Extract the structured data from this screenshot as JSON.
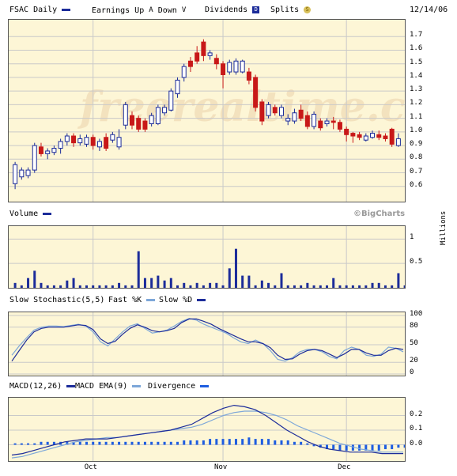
{
  "header": {
    "symbol_label": "FSAC Daily",
    "earnings_label": "Earnings Up",
    "earnings_up_glyph": "A",
    "earnings_down_label": "Down",
    "earnings_down_glyph": "V",
    "dividends_label": "Dividends",
    "dividends_glyph": "D",
    "splits_label": "Splits",
    "splits_glyph": "S",
    "date": "12/14/06"
  },
  "watermark": "freerealtime.com",
  "copyright": "©BigCharts",
  "panels": {
    "volume_label": "Volume",
    "volume_units": "Millions",
    "stoch_label": "Slow Stochastic(5,5)",
    "stoch_fast": "Fast %K",
    "stoch_slow": "Slow %D",
    "macd_label": "MACD(12,26)",
    "macd_ema": "MACD EMA(9)",
    "macd_div": "Divergence"
  },
  "colors": {
    "up": "#1c2c9a",
    "down": "#c81818",
    "fast": "#7da7d9",
    "panel_bg": "#fdf6d6",
    "grid": "#c9c9c9"
  },
  "chart_data": {
    "type": "candlestick",
    "x_ticks": [
      "Oct",
      "Nov",
      "Dec"
    ],
    "x_tick_index": [
      12,
      32,
      51
    ],
    "price_axis": {
      "ylim": [
        0.5,
        1.8
      ],
      "ticks": [
        0.6,
        0.7,
        0.8,
        0.9,
        1.0,
        1.1,
        1.2,
        1.3,
        1.4,
        1.5,
        1.6,
        1.7
      ]
    },
    "candles": [
      {
        "o": 0.62,
        "c": 0.76,
        "h": 0.78,
        "l": 0.58
      },
      {
        "o": 0.67,
        "c": 0.72,
        "h": 0.74,
        "l": 0.65
      },
      {
        "o": 0.68,
        "c": 0.72,
        "h": 0.74,
        "l": 0.66
      },
      {
        "o": 0.72,
        "c": 0.9,
        "h": 0.92,
        "l": 0.7
      },
      {
        "o": 0.89,
        "c": 0.84,
        "h": 0.92,
        "l": 0.82
      },
      {
        "o": 0.84,
        "c": 0.86,
        "h": 0.88,
        "l": 0.8
      },
      {
        "o": 0.85,
        "c": 0.88,
        "h": 0.9,
        "l": 0.83
      },
      {
        "o": 0.88,
        "c": 0.93,
        "h": 0.95,
        "l": 0.84
      },
      {
        "o": 0.93,
        "c": 0.97,
        "h": 0.99,
        "l": 0.9
      },
      {
        "o": 0.97,
        "c": 0.92,
        "h": 0.99,
        "l": 0.89
      },
      {
        "o": 0.92,
        "c": 0.95,
        "h": 0.98,
        "l": 0.9
      },
      {
        "o": 0.91,
        "c": 0.96,
        "h": 0.98,
        "l": 0.89
      },
      {
        "o": 0.96,
        "c": 0.9,
        "h": 0.98,
        "l": 0.87
      },
      {
        "o": 0.89,
        "c": 0.93,
        "h": 0.95,
        "l": 0.86
      },
      {
        "o": 0.96,
        "c": 0.88,
        "h": 0.99,
        "l": 0.86
      },
      {
        "o": 0.94,
        "c": 0.98,
        "h": 1.0,
        "l": 0.92
      },
      {
        "o": 0.89,
        "c": 0.96,
        "h": 1.02,
        "l": 0.87
      },
      {
        "o": 1.05,
        "c": 1.2,
        "h": 1.22,
        "l": 1.02
      },
      {
        "o": 1.12,
        "c": 1.05,
        "h": 1.15,
        "l": 1.02
      },
      {
        "o": 1.1,
        "c": 1.02,
        "h": 1.12,
        "l": 1.0
      },
      {
        "o": 1.08,
        "c": 1.02,
        "h": 1.1,
        "l": 1.0
      },
      {
        "o": 1.06,
        "c": 1.12,
        "h": 1.14,
        "l": 1.04
      },
      {
        "o": 1.06,
        "c": 1.18,
        "h": 1.2,
        "l": 1.05
      },
      {
        "o": 1.14,
        "c": 1.18,
        "h": 1.2,
        "l": 1.12
      },
      {
        "o": 1.16,
        "c": 1.3,
        "h": 1.32,
        "l": 1.15
      },
      {
        "o": 1.28,
        "c": 1.38,
        "h": 1.4,
        "l": 1.25
      },
      {
        "o": 1.4,
        "c": 1.48,
        "h": 1.5,
        "l": 1.37
      },
      {
        "o": 1.52,
        "c": 1.48,
        "h": 1.55,
        "l": 1.44
      },
      {
        "o": 1.58,
        "c": 1.52,
        "h": 1.63,
        "l": 1.5
      },
      {
        "o": 1.66,
        "c": 1.56,
        "h": 1.68,
        "l": 1.52
      },
      {
        "o": 1.56,
        "c": 1.58,
        "h": 1.6,
        "l": 1.53
      },
      {
        "o": 1.54,
        "c": 1.5,
        "h": 1.57,
        "l": 1.46
      },
      {
        "o": 1.5,
        "c": 1.42,
        "h": 1.52,
        "l": 1.32
      },
      {
        "o": 1.44,
        "c": 1.51,
        "h": 1.53,
        "l": 1.42
      },
      {
        "o": 1.44,
        "c": 1.52,
        "h": 1.54,
        "l": 1.42
      },
      {
        "o": 1.44,
        "c": 1.52,
        "h": 1.53,
        "l": 1.43
      },
      {
        "o": 1.44,
        "c": 1.38,
        "h": 1.47,
        "l": 1.35
      },
      {
        "o": 1.4,
        "c": 1.18,
        "h": 1.42,
        "l": 1.15
      },
      {
        "o": 1.22,
        "c": 1.08,
        "h": 1.24,
        "l": 1.05
      },
      {
        "o": 1.12,
        "c": 1.2,
        "h": 1.22,
        "l": 1.1
      },
      {
        "o": 1.18,
        "c": 1.14,
        "h": 1.2,
        "l": 1.12
      },
      {
        "o": 1.12,
        "c": 1.18,
        "h": 1.2,
        "l": 1.1
      },
      {
        "o": 1.08,
        "c": 1.1,
        "h": 1.13,
        "l": 1.05
      },
      {
        "o": 1.08,
        "c": 1.14,
        "h": 1.17,
        "l": 1.06
      },
      {
        "o": 1.16,
        "c": 1.1,
        "h": 1.2,
        "l": 1.08
      },
      {
        "o": 1.12,
        "c": 1.04,
        "h": 1.15,
        "l": 1.02
      },
      {
        "o": 1.04,
        "c": 1.13,
        "h": 1.15,
        "l": 1.02
      },
      {
        "o": 1.08,
        "c": 1.03,
        "h": 1.1,
        "l": 1.01
      },
      {
        "o": 1.06,
        "c": 1.08,
        "h": 1.1,
        "l": 1.04
      },
      {
        "o": 1.08,
        "c": 1.07,
        "h": 1.11,
        "l": 1.02
      },
      {
        "o": 1.07,
        "c": 1.02,
        "h": 1.09,
        "l": 1.0
      },
      {
        "o": 1.02,
        "c": 0.98,
        "h": 1.04,
        "l": 0.93
      },
      {
        "o": 0.99,
        "c": 0.97,
        "h": 1.0,
        "l": 0.92
      },
      {
        "o": 0.98,
        "c": 0.96,
        "h": 1.0,
        "l": 0.94
      },
      {
        "o": 0.94,
        "c": 0.97,
        "h": 0.99,
        "l": 0.93
      },
      {
        "o": 0.96,
        "c": 0.99,
        "h": 1.01,
        "l": 0.95
      },
      {
        "o": 0.98,
        "c": 0.96,
        "h": 1.01,
        "l": 0.94
      },
      {
        "o": 0.97,
        "c": 0.95,
        "h": 0.99,
        "l": 0.93
      },
      {
        "o": 1.02,
        "c": 0.91,
        "h": 1.03,
        "l": 0.89
      },
      {
        "o": 0.9,
        "c": 0.95,
        "h": 0.99,
        "l": 0.89
      }
    ],
    "volume": {
      "ylim": [
        0,
        1.2
      ],
      "ticks": [
        0.5,
        1
      ],
      "values": [
        0.1,
        0.05,
        0.2,
        0.35,
        0.1,
        0.05,
        0.05,
        0.05,
        0.15,
        0.2,
        0.05,
        0.05,
        0.05,
        0.05,
        0.05,
        0.05,
        0.1,
        0.05,
        0.05,
        0.75,
        0.2,
        0.2,
        0.25,
        0.15,
        0.2,
        0.05,
        0.1,
        0.05,
        0.1,
        0.05,
        0.1,
        0.1,
        0.05,
        0.4,
        0.8,
        0.25,
        0.25,
        0.05,
        0.15,
        0.1,
        0.05,
        0.3,
        0.05,
        0.05,
        0.05,
        0.1,
        0.05,
        0.05,
        0.05,
        0.2,
        0.05,
        0.05,
        0.05,
        0.05,
        0.05,
        0.1,
        0.1,
        0.05,
        0.05,
        0.3,
        0.05,
        0.05,
        0.1,
        1.15
      ]
    },
    "stochastic": {
      "ylim": [
        0,
        100
      ],
      "ticks": [
        0,
        20,
        50,
        80,
        100
      ],
      "fast_k": [
        32,
        48,
        62,
        75,
        80,
        82,
        82,
        81,
        83,
        85,
        82,
        72,
        55,
        48,
        60,
        72,
        82,
        86,
        78,
        70,
        72,
        75,
        82,
        90,
        95,
        92,
        85,
        80,
        75,
        70,
        62,
        55,
        52,
        58,
        52,
        40,
        25,
        22,
        28,
        38,
        42,
        42,
        38,
        30,
        26,
        40,
        46,
        42,
        32,
        30,
        34,
        46,
        44,
        38
      ],
      "slow_d": [
        22,
        40,
        58,
        72,
        78,
        80,
        80,
        80,
        82,
        84,
        83,
        76,
        60,
        52,
        56,
        68,
        78,
        84,
        80,
        74,
        72,
        74,
        78,
        88,
        94,
        94,
        90,
        85,
        78,
        72,
        66,
        60,
        55,
        55,
        52,
        45,
        32,
        25,
        26,
        34,
        40,
        42,
        40,
        34,
        28,
        34,
        42,
        42,
        36,
        32,
        32,
        40,
        44,
        42
      ]
    },
    "macd": {
      "ylim": [
        -0.1,
        0.3
      ],
      "ticks": [
        0.0,
        0.1,
        0.2
      ],
      "macd": [
        -0.07,
        -0.06,
        -0.04,
        -0.02,
        0.0,
        0.02,
        0.03,
        0.04,
        0.04,
        0.04,
        0.05,
        0.06,
        0.07,
        0.08,
        0.09,
        0.1,
        0.12,
        0.14,
        0.18,
        0.22,
        0.25,
        0.27,
        0.26,
        0.24,
        0.2,
        0.15,
        0.1,
        0.06,
        0.02,
        -0.01,
        -0.03,
        -0.04,
        -0.05,
        -0.05,
        -0.05,
        -0.06,
        -0.06,
        -0.06
      ],
      "ema": [
        -0.09,
        -0.08,
        -0.06,
        -0.04,
        -0.02,
        0.0,
        0.02,
        0.03,
        0.04,
        0.05,
        0.05,
        0.06,
        0.07,
        0.08,
        0.09,
        0.1,
        0.11,
        0.12,
        0.14,
        0.17,
        0.2,
        0.22,
        0.23,
        0.23,
        0.22,
        0.2,
        0.17,
        0.13,
        0.1,
        0.07,
        0.04,
        0.01,
        -0.01,
        -0.03,
        -0.04,
        -0.05,
        -0.05,
        -0.05
      ],
      "divergence": [
        0.01,
        0.01,
        0.01,
        0.01,
        0.02,
        0.02,
        0.02,
        0.02,
        0.02,
        0.02,
        0.02,
        0.02,
        0.02,
        0.02,
        0.02,
        0.02,
        0.02,
        0.02,
        0.02,
        0.02,
        0.02,
        0.02,
        0.02,
        0.02,
        0.02,
        0.02,
        0.03,
        0.03,
        0.03,
        0.03,
        0.04,
        0.04,
        0.04,
        0.04,
        0.04,
        0.04,
        0.05,
        0.04,
        0.04,
        0.04,
        0.03,
        0.03,
        0.03,
        0.02,
        0.02,
        0.01,
        -0.01,
        -0.02,
        -0.03,
        -0.03,
        -0.04,
        -0.04,
        -0.04,
        -0.04,
        -0.04,
        -0.04,
        -0.04,
        -0.03,
        -0.03,
        -0.02,
        -0.02,
        -0.01,
        -0.01,
        -0.01
      ]
    }
  }
}
